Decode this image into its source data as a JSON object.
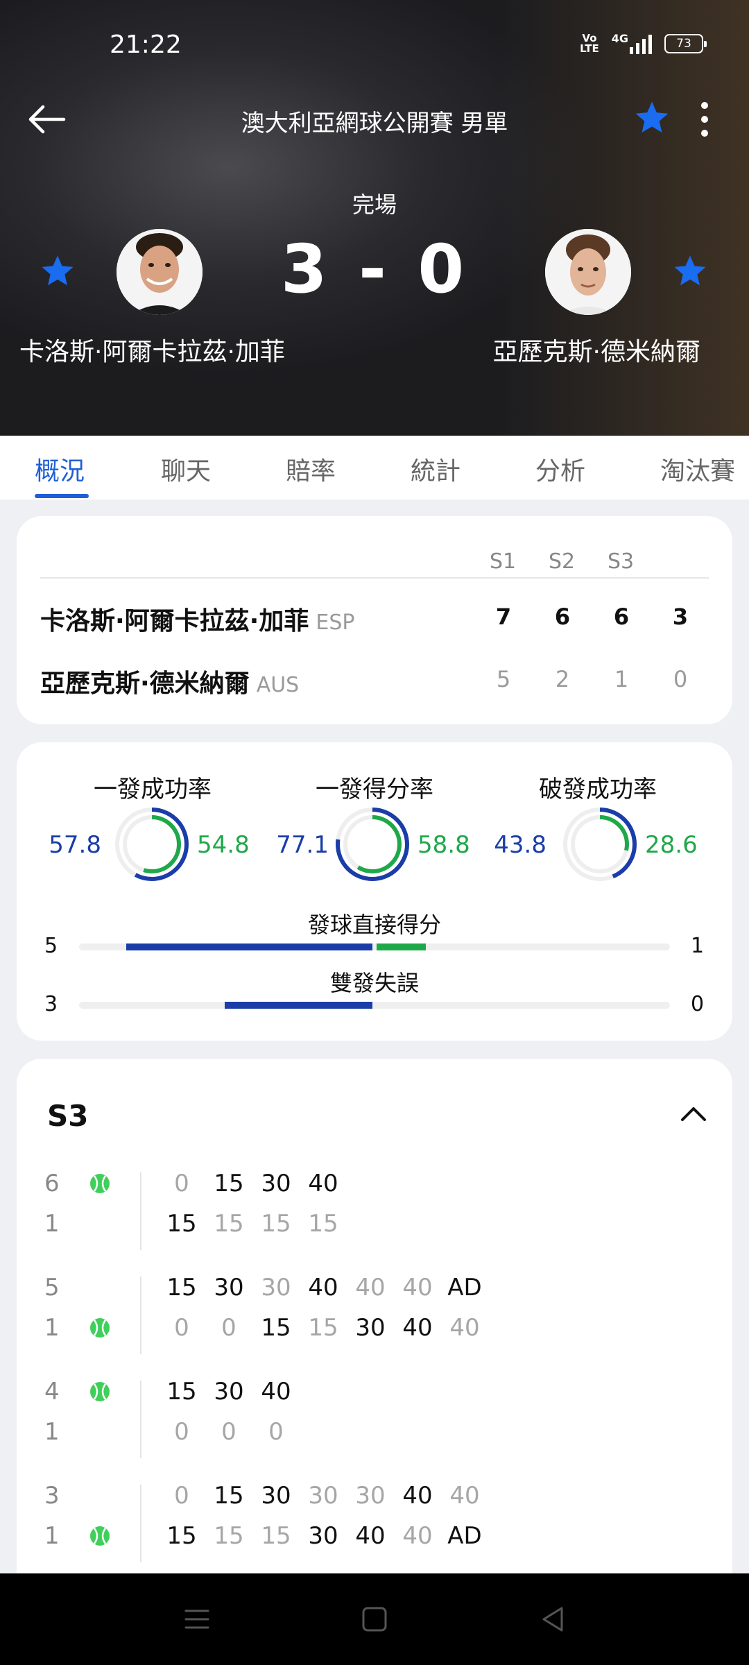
{
  "status_bar": {
    "time": "21:22",
    "network": "4G",
    "volte": "Vo LTE",
    "battery": "73"
  },
  "header": {
    "title": "澳大利亞網球公開賽 男單",
    "status": "完場",
    "score": "3 - 0"
  },
  "players": {
    "left": {
      "name": "卡洛斯·阿爾卡拉茲·加菲",
      "country": "ESP"
    },
    "right": {
      "name": "亞歷克斯·德米納爾",
      "country": "AUS"
    }
  },
  "tabs": [
    "概況",
    "聊天",
    "賠率",
    "統計",
    "分析",
    "淘汰賽"
  ],
  "scoreboard": {
    "headers": [
      "S1",
      "S2",
      "S3"
    ],
    "rows": [
      {
        "name": "卡洛斯·阿爾卡拉茲·加菲",
        "country": "ESP",
        "scores": [
          "7",
          "6",
          "6",
          "3"
        ]
      },
      {
        "name": "亞歷克斯·德米納爾",
        "country": "AUS",
        "scores": [
          "5",
          "2",
          "1",
          "0"
        ]
      }
    ]
  },
  "stats": {
    "rings": [
      {
        "label": "一發成功率",
        "left": "57.8",
        "right": "54.8",
        "left_pct": 57.8,
        "right_pct": 54.8
      },
      {
        "label": "一發得分率",
        "left": "77.1",
        "right": "58.8",
        "left_pct": 77.1,
        "right_pct": 58.8
      },
      {
        "label": "破發成功率",
        "left": "43.8",
        "right": "28.6",
        "left_pct": 43.8,
        "right_pct": 28.6
      }
    ],
    "bars": [
      {
        "label": "發球直接得分",
        "left": "5",
        "right": "1",
        "left_value": 5,
        "right_value": 1
      },
      {
        "label": "雙發失誤",
        "left": "3",
        "right": "0",
        "left_value": 3,
        "right_value": 0
      }
    ]
  },
  "set_detail": {
    "title": "S3",
    "games": [
      {
        "top_game": "6",
        "bottom_game": "1",
        "server": "top",
        "top_points": [
          [
            "0",
            "light"
          ],
          [
            "15",
            "dark"
          ],
          [
            "30",
            "dark"
          ],
          [
            "40",
            "dark"
          ]
        ],
        "bottom_points": [
          [
            "15",
            "dark"
          ],
          [
            "15",
            "light"
          ],
          [
            "15",
            "light"
          ],
          [
            "15",
            "light"
          ]
        ]
      },
      {
        "top_game": "5",
        "bottom_game": "1",
        "server": "bottom",
        "top_points": [
          [
            "15",
            "dark"
          ],
          [
            "30",
            "dark"
          ],
          [
            "30",
            "light"
          ],
          [
            "40",
            "dark"
          ],
          [
            "40",
            "light"
          ],
          [
            "40",
            "light"
          ],
          [
            "AD",
            "dark"
          ]
        ],
        "bottom_points": [
          [
            "0",
            "light"
          ],
          [
            "0",
            "light"
          ],
          [
            "15",
            "dark"
          ],
          [
            "15",
            "light"
          ],
          [
            "30",
            "dark"
          ],
          [
            "40",
            "dark"
          ],
          [
            "40",
            "light"
          ]
        ]
      },
      {
        "top_game": "4",
        "bottom_game": "1",
        "server": "top",
        "top_points": [
          [
            "15",
            "dark"
          ],
          [
            "30",
            "dark"
          ],
          [
            "40",
            "dark"
          ]
        ],
        "bottom_points": [
          [
            "0",
            "light"
          ],
          [
            "0",
            "light"
          ],
          [
            "0",
            "light"
          ]
        ]
      },
      {
        "top_game": "3",
        "bottom_game": "1",
        "server": "bottom",
        "top_points": [
          [
            "0",
            "light"
          ],
          [
            "15",
            "dark"
          ],
          [
            "30",
            "dark"
          ],
          [
            "30",
            "light"
          ],
          [
            "30",
            "light"
          ],
          [
            "40",
            "dark"
          ],
          [
            "40",
            "light"
          ]
        ],
        "bottom_points": [
          [
            "15",
            "dark"
          ],
          [
            "15",
            "light"
          ],
          [
            "15",
            "light"
          ],
          [
            "30",
            "dark"
          ],
          [
            "40",
            "dark"
          ],
          [
            "40",
            "light"
          ],
          [
            "AD",
            "dark"
          ]
        ]
      }
    ]
  },
  "colors": {
    "accent": "#1f5fd6",
    "star": "#1a6cf0",
    "left_player": "#1a3da8",
    "right_player": "#1fa84a",
    "ball": "#3fcf5a"
  },
  "icons": {
    "back": "back-arrow-icon",
    "favorite": "star-icon",
    "more": "more-vertical-icon",
    "collapse": "chevron-up-icon",
    "server": "tennis-ball-icon"
  }
}
